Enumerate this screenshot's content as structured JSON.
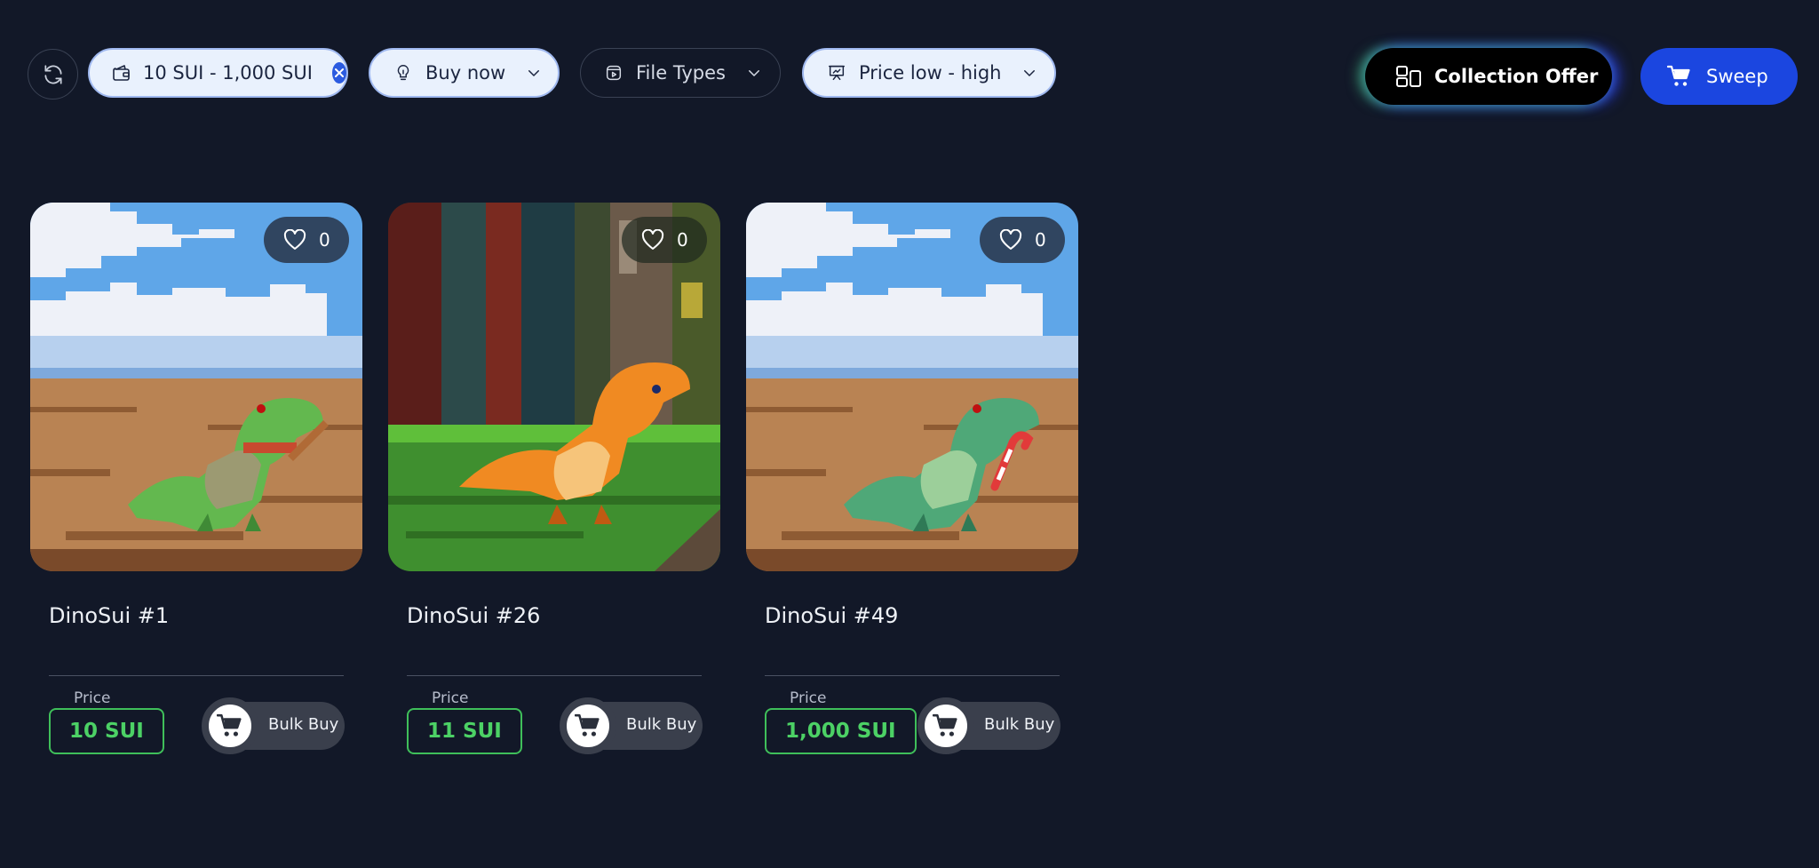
{
  "filters": {
    "price_range": "10 SUI - 1,000 SUI",
    "buy_mode": "Buy now",
    "file_types": "File Types",
    "sort": "Price low - high"
  },
  "actions": {
    "collection_offer": "Collection Offer",
    "sweep": "Sweep"
  },
  "colors": {
    "background": "#121828",
    "accent_blue": "#1b46e0",
    "price_green": "#4cd165"
  },
  "items": [
    {
      "name": "DinoSui #1",
      "likes": "0",
      "price_label": "Price",
      "price": "10 SUI",
      "bulk_label": "Bulk Buy",
      "image": "green-dino-with-bat-desert"
    },
    {
      "name": "DinoSui #26",
      "likes": "0",
      "price_label": "Price",
      "price": "11 SUI",
      "bulk_label": "Bulk Buy",
      "image": "orange-dino-forest"
    },
    {
      "name": "DinoSui #49",
      "likes": "0",
      "price_label": "Price",
      "price": "1,000 SUI",
      "bulk_label": "Bulk Buy",
      "image": "green-dino-candy-cane-desert"
    }
  ]
}
